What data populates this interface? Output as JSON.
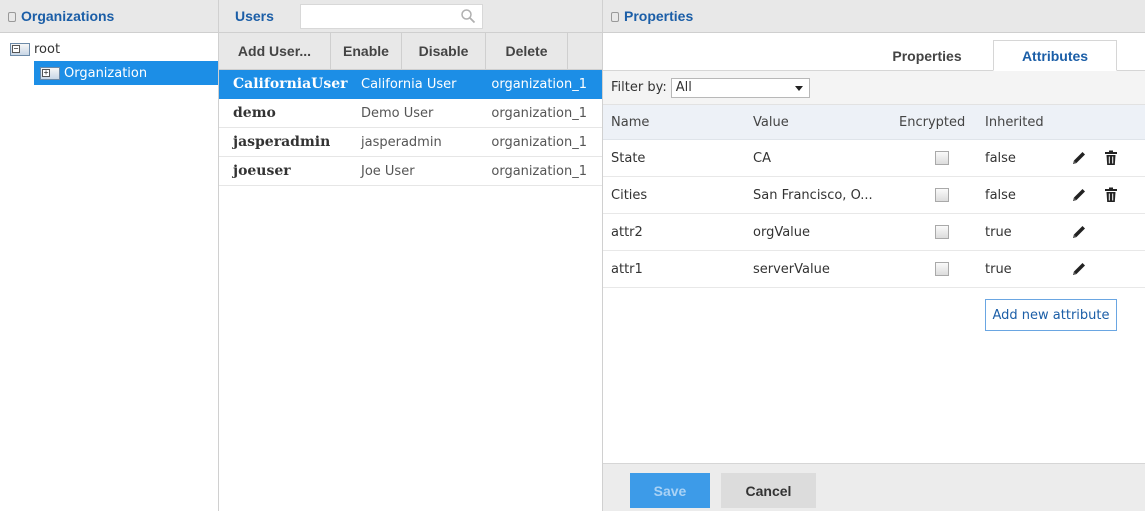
{
  "organizations": {
    "title": "Organizations",
    "tree": {
      "root_label": "root",
      "child_label": "Organization"
    }
  },
  "users": {
    "title": "Users",
    "search_placeholder": "",
    "toolbar": {
      "add_label": "Add User...",
      "enable_label": "Enable",
      "disable_label": "Disable",
      "delete_label": "Delete"
    },
    "rows": [
      {
        "id": "CaliforniaUser",
        "name": "California User",
        "org": "organization_1",
        "selected": true
      },
      {
        "id": "demo",
        "name": "Demo User",
        "org": "organization_1",
        "selected": false
      },
      {
        "id": "jasperadmin",
        "name": "jasperadmin",
        "org": "organization_1",
        "selected": false
      },
      {
        "id": "joeuser",
        "name": "Joe User",
        "org": "organization_1",
        "selected": false
      }
    ]
  },
  "properties": {
    "title": "Properties",
    "tabs": [
      {
        "label": "Properties",
        "active": false
      },
      {
        "label": "Attributes",
        "active": true
      }
    ],
    "filter": {
      "label": "Filter by:",
      "value": "All"
    },
    "columns": {
      "name": "Name",
      "value": "Value",
      "encrypted": "Encrypted",
      "inherited": "Inherited"
    },
    "rows": [
      {
        "name": "State",
        "value": "CA",
        "encrypted": false,
        "inherited": "false",
        "deletable": true
      },
      {
        "name": "Cities",
        "value": "San Francisco, O...",
        "encrypted": false,
        "inherited": "false",
        "deletable": true
      },
      {
        "name": "attr2",
        "value": "orgValue",
        "encrypted": false,
        "inherited": "true",
        "deletable": false
      },
      {
        "name": "attr1",
        "value": "serverValue",
        "encrypted": false,
        "inherited": "true",
        "deletable": false
      }
    ],
    "add_attribute_label": "Add new attribute",
    "footer": {
      "save_label": "Save",
      "cancel_label": "Cancel"
    }
  },
  "icons": {
    "collapse": "collapse-panel-icon",
    "folder": "folder-icon",
    "search": "search-icon",
    "edit": "pencil-icon",
    "delete": "trash-icon",
    "dropdown": "chevron-down-icon"
  },
  "colors": {
    "accent": "#1c8ee6",
    "title_blue": "#1b5ea7",
    "save_button": "#3d9be8"
  }
}
